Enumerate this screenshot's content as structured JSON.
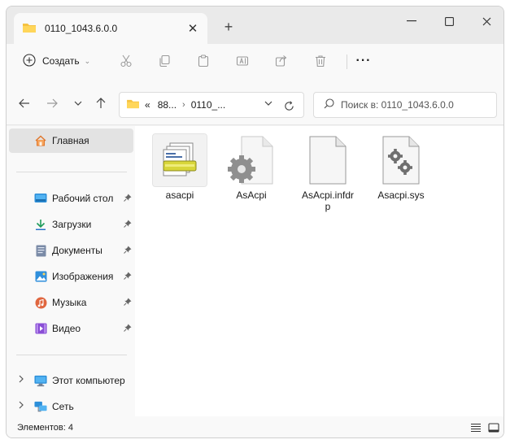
{
  "tab": {
    "title": "0110_1043.6.0.0",
    "close": "✕",
    "new_tab": "+"
  },
  "window_controls": {
    "minimize": "—",
    "maximize": "☐",
    "close": "✕"
  },
  "toolbar": {
    "create_label": "Создать",
    "create_chevron": "⌄",
    "icons": [
      "cut-icon",
      "copy-icon",
      "paste-icon",
      "rename-icon",
      "share-icon",
      "delete-icon"
    ],
    "more": "···"
  },
  "address": {
    "crumbs": [
      "«",
      "88...",
      "›",
      "0110_..."
    ],
    "chevron": "⌄"
  },
  "search": {
    "placeholder": "Поиск в: 0110_1043.6.0.0"
  },
  "sidebar": {
    "home": "Главная",
    "quick_access": [
      {
        "label": "Рабочий стол",
        "icon": "desktop-icon"
      },
      {
        "label": "Загрузки",
        "icon": "downloads-icon"
      },
      {
        "label": "Документы",
        "icon": "documents-icon"
      },
      {
        "label": "Изображения",
        "icon": "pictures-icon"
      },
      {
        "label": "Музыка",
        "icon": "music-icon"
      },
      {
        "label": "Видео",
        "icon": "videos-icon"
      }
    ],
    "this_pc": "Этот компьютер",
    "network": "Сеть"
  },
  "files": [
    {
      "name": "asacpi",
      "icon": "batch-file-icon",
      "selected": true
    },
    {
      "name": "AsAcpi",
      "icon": "settings-file-icon",
      "selected": false
    },
    {
      "name": "AsAcpi.infdrp",
      "icon": "blank-file-icon",
      "selected": false
    },
    {
      "name": "Asacpi.sys",
      "icon": "system-file-icon",
      "selected": false
    }
  ],
  "status": {
    "items_count": "Элементов: 4"
  },
  "colors": {
    "folder": "#f5c242",
    "accent": "#1a73c7"
  }
}
